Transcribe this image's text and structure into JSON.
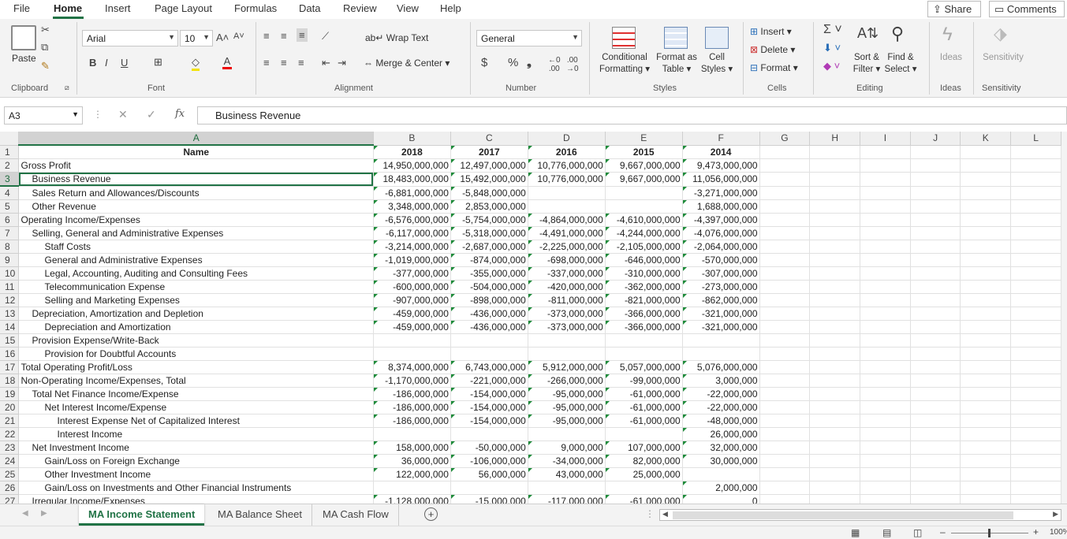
{
  "menu": {
    "tabs": [
      "File",
      "Home",
      "Insert",
      "Page Layout",
      "Formulas",
      "Data",
      "Review",
      "View",
      "Help"
    ],
    "share_label": "Share",
    "comments_label": "Comments"
  },
  "ribbon": {
    "clipboard": {
      "paste": "Paste",
      "group": "Clipboard"
    },
    "font": {
      "family": "Arial",
      "size": "10",
      "bold": "B",
      "italic": "I",
      "underline": "U",
      "group": "Font"
    },
    "alignment": {
      "wrap": "Wrap Text",
      "merge": "Merge & Center",
      "group": "Alignment"
    },
    "number": {
      "format": "General",
      "currency": "$",
      "percent": "%",
      "comma": "❟",
      "group": "Number"
    },
    "styles": {
      "conditional": "Conditional",
      "conditional2": "Formatting",
      "format_as": "Format as",
      "format_as2": "Table",
      "cell": "Cell",
      "cell2": "Styles",
      "group": "Styles"
    },
    "cells": {
      "insert": "Insert",
      "delete": "Delete",
      "format": "Format",
      "group": "Cells"
    },
    "editing": {
      "sort": "Sort &",
      "sort2": "Filter",
      "find": "Find &",
      "find2": "Select",
      "group": "Editing"
    },
    "ideas": {
      "label": "Ideas",
      "group": "Ideas"
    },
    "sensitivity": {
      "label": "Sensitivity",
      "group": "Sensitivity"
    }
  },
  "formula_bar": {
    "cell_ref": "A3",
    "fx": "fx",
    "content": "Business Revenue"
  },
  "columns": [
    "A",
    "B",
    "C",
    "D",
    "E",
    "F",
    "G",
    "H",
    "I",
    "J",
    "K",
    "L"
  ],
  "rows": [
    {
      "n": "1",
      "indent": 0,
      "a": "Name",
      "vals": [
        "2018",
        "2017",
        "2016",
        "2015",
        "2014"
      ],
      "hdr": true
    },
    {
      "n": "2",
      "indent": 0,
      "a": "Gross Profit",
      "vals": [
        "14,950,000,000",
        "12,497,000,000",
        "10,776,000,000",
        "9,667,000,000",
        "9,473,000,000"
      ]
    },
    {
      "n": "3",
      "indent": 1,
      "a": "Business Revenue",
      "vals": [
        "18,483,000,000",
        "15,492,000,000",
        "10,776,000,000",
        "9,667,000,000",
        "11,056,000,000"
      ]
    },
    {
      "n": "4",
      "indent": 1,
      "a": "Sales Return and Allowances/Discounts",
      "vals": [
        "-6,881,000,000",
        "-5,848,000,000",
        "",
        "",
        "-3,271,000,000"
      ]
    },
    {
      "n": "5",
      "indent": 1,
      "a": "Other Revenue",
      "vals": [
        "3,348,000,000",
        "2,853,000,000",
        "",
        "",
        "1,688,000,000"
      ]
    },
    {
      "n": "6",
      "indent": 0,
      "a": "Operating Income/Expenses",
      "vals": [
        "-6,576,000,000",
        "-5,754,000,000",
        "-4,864,000,000",
        "-4,610,000,000",
        "-4,397,000,000"
      ]
    },
    {
      "n": "7",
      "indent": 1,
      "a": "Selling, General and Administrative Expenses",
      "vals": [
        "-6,117,000,000",
        "-5,318,000,000",
        "-4,491,000,000",
        "-4,244,000,000",
        "-4,076,000,000"
      ]
    },
    {
      "n": "8",
      "indent": 2,
      "a": "Staff Costs",
      "vals": [
        "-3,214,000,000",
        "-2,687,000,000",
        "-2,225,000,000",
        "-2,105,000,000",
        "-2,064,000,000"
      ]
    },
    {
      "n": "9",
      "indent": 2,
      "a": "General and Administrative Expenses",
      "vals": [
        "-1,019,000,000",
        "-874,000,000",
        "-698,000,000",
        "-646,000,000",
        "-570,000,000"
      ]
    },
    {
      "n": "10",
      "indent": 2,
      "a": "Legal, Accounting, Auditing and Consulting Fees",
      "vals": [
        "-377,000,000",
        "-355,000,000",
        "-337,000,000",
        "-310,000,000",
        "-307,000,000"
      ]
    },
    {
      "n": "11",
      "indent": 2,
      "a": "Telecommunication Expense",
      "vals": [
        "-600,000,000",
        "-504,000,000",
        "-420,000,000",
        "-362,000,000",
        "-273,000,000"
      ]
    },
    {
      "n": "12",
      "indent": 2,
      "a": "Selling and Marketing Expenses",
      "vals": [
        "-907,000,000",
        "-898,000,000",
        "-811,000,000",
        "-821,000,000",
        "-862,000,000"
      ]
    },
    {
      "n": "13",
      "indent": 1,
      "a": "Depreciation, Amortization and Depletion",
      "vals": [
        "-459,000,000",
        "-436,000,000",
        "-373,000,000",
        "-366,000,000",
        "-321,000,000"
      ]
    },
    {
      "n": "14",
      "indent": 2,
      "a": "Depreciation and Amortization",
      "vals": [
        "-459,000,000",
        "-436,000,000",
        "-373,000,000",
        "-366,000,000",
        "-321,000,000"
      ]
    },
    {
      "n": "15",
      "indent": 1,
      "a": "Provision Expense/Write-Back",
      "vals": [
        "",
        "",
        "",
        "",
        ""
      ]
    },
    {
      "n": "16",
      "indent": 2,
      "a": "Provision for Doubtful Accounts",
      "vals": [
        "",
        "",
        "",
        "",
        ""
      ]
    },
    {
      "n": "17",
      "indent": 0,
      "a": "Total Operating Profit/Loss",
      "vals": [
        "8,374,000,000",
        "6,743,000,000",
        "5,912,000,000",
        "5,057,000,000",
        "5,076,000,000"
      ]
    },
    {
      "n": "18",
      "indent": 0,
      "a": "Non-Operating Income/Expenses, Total",
      "vals": [
        "-1,170,000,000",
        "-221,000,000",
        "-266,000,000",
        "-99,000,000",
        "3,000,000"
      ]
    },
    {
      "n": "19",
      "indent": 1,
      "a": "Total Net Finance Income/Expense",
      "vals": [
        "-186,000,000",
        "-154,000,000",
        "-95,000,000",
        "-61,000,000",
        "-22,000,000"
      ]
    },
    {
      "n": "20",
      "indent": 2,
      "a": "Net Interest Income/Expense",
      "vals": [
        "-186,000,000",
        "-154,000,000",
        "-95,000,000",
        "-61,000,000",
        "-22,000,000"
      ]
    },
    {
      "n": "21",
      "indent": 3,
      "a": "Interest Expense Net of Capitalized Interest",
      "vals": [
        "-186,000,000",
        "-154,000,000",
        "-95,000,000",
        "-61,000,000",
        "-48,000,000"
      ]
    },
    {
      "n": "22",
      "indent": 3,
      "a": "Interest Income",
      "vals": [
        "",
        "",
        "",
        "",
        "26,000,000"
      ]
    },
    {
      "n": "23",
      "indent": 1,
      "a": "Net Investment Income",
      "vals": [
        "158,000,000",
        "-50,000,000",
        "9,000,000",
        "107,000,000",
        "32,000,000"
      ]
    },
    {
      "n": "24",
      "indent": 2,
      "a": "Gain/Loss on Foreign Exchange",
      "vals": [
        "36,000,000",
        "-106,000,000",
        "-34,000,000",
        "82,000,000",
        "30,000,000"
      ]
    },
    {
      "n": "25",
      "indent": 2,
      "a": "Other Investment Income",
      "vals": [
        "122,000,000",
        "56,000,000",
        "43,000,000",
        "25,000,000",
        ""
      ]
    },
    {
      "n": "26",
      "indent": 2,
      "a": "Gain/Loss on Investments and Other Financial Instruments",
      "vals": [
        "",
        "",
        "",
        "",
        "2,000,000"
      ]
    },
    {
      "n": "27",
      "indent": 1,
      "a": "Irregular Income/Expenses",
      "vals": [
        "-1,128,000,000",
        "-15,000,000",
        "-117,000,000",
        "-61,000,000",
        "0"
      ]
    }
  ],
  "sheets": [
    "MA Income Statement",
    "MA Balance Sheet",
    "MA Cash Flow"
  ],
  "status": {
    "zoom": "100%"
  }
}
